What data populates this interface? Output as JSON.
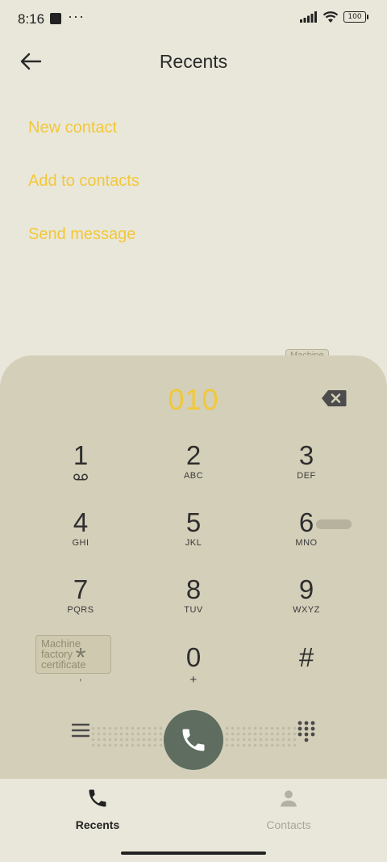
{
  "status_bar": {
    "time": "8:16",
    "dots": "···",
    "battery": "100"
  },
  "header": {
    "title": "Recents",
    "back_icon": "arrow-left-icon"
  },
  "actions": [
    {
      "label": "New contact"
    },
    {
      "label": "Add to contacts"
    },
    {
      "label": "Send message"
    }
  ],
  "dialer": {
    "number": "010",
    "keys": [
      {
        "digit": "1",
        "letters": ""
      },
      {
        "digit": "2",
        "letters": "ABC"
      },
      {
        "digit": "3",
        "letters": "DEF"
      },
      {
        "digit": "4",
        "letters": "GHI"
      },
      {
        "digit": "5",
        "letters": "JKL"
      },
      {
        "digit": "6",
        "letters": "MNO"
      },
      {
        "digit": "7",
        "letters": "PQRS"
      },
      {
        "digit": "8",
        "letters": "TUV"
      },
      {
        "digit": "9",
        "letters": "WXYZ"
      },
      {
        "digit": "*",
        "letters": ","
      },
      {
        "digit": "0",
        "letters": "+"
      },
      {
        "digit": "#",
        "letters": ""
      }
    ]
  },
  "stickers": {
    "top": "Machine",
    "bottom_lines": [
      "Machine",
      "factory",
      "certificate"
    ]
  },
  "bottom_nav": {
    "recents_label": "Recents",
    "contacts_label": "Contacts"
  },
  "colors": {
    "accent": "#F2C838",
    "call_button": "#5F6D60",
    "dialer_bg": "#D4CFB9",
    "page_bg": "#E9E7DA"
  }
}
